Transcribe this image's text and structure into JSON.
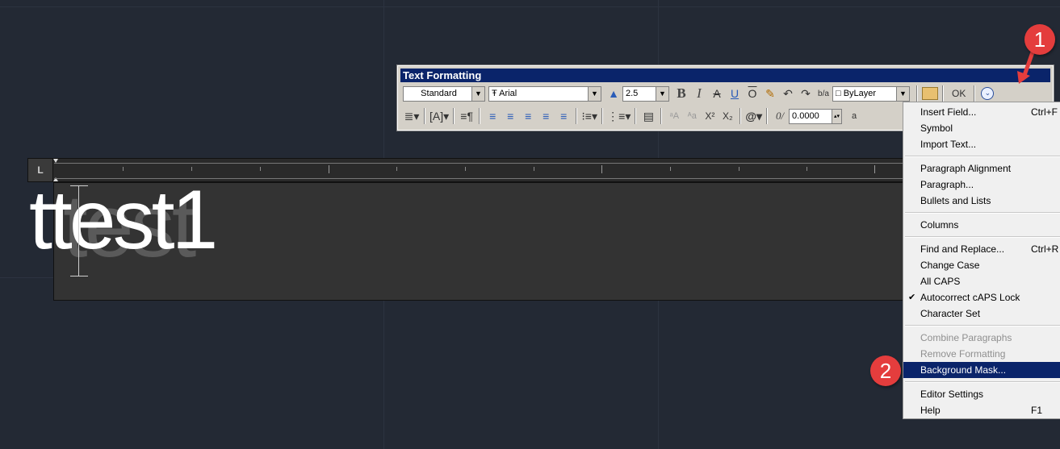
{
  "toolbar": {
    "title": "Text Formatting",
    "style_value": "Standard",
    "font_value": "Arial",
    "height_value": "2.5",
    "bold": "B",
    "italic": "I",
    "strike": "A",
    "underline": "U",
    "overline": "O",
    "undo": "↶",
    "redo": "↷",
    "stack": "b/a",
    "color_value": "ByLayer",
    "ok_label": "OK",
    "oblique_value": "0.0000",
    "at_symbol": "@",
    "oblique_label": "0/",
    "superscript": "X²",
    "subscript": "X₂"
  },
  "editor": {
    "ruler_corner": "L",
    "ghost_text": "test",
    "main_text": "ttest1"
  },
  "menu": {
    "items": [
      {
        "label": "Insert Field...",
        "shortcut": "Ctrl+F"
      },
      {
        "label": "Symbol",
        "shortcut": ""
      },
      {
        "label": "Import Text...",
        "shortcut": ""
      },
      {
        "label": "Paragraph Alignment",
        "shortcut": ""
      },
      {
        "label": "Paragraph...",
        "shortcut": ""
      },
      {
        "label": "Bullets and Lists",
        "shortcut": ""
      },
      {
        "label": "Columns",
        "shortcut": ""
      },
      {
        "label": "Find and Replace...",
        "shortcut": "Ctrl+R"
      },
      {
        "label": "Change Case",
        "shortcut": ""
      },
      {
        "label": "All CAPS",
        "shortcut": ""
      },
      {
        "label": "Autocorrect cAPS Lock",
        "shortcut": "",
        "checked": "✔"
      },
      {
        "label": "Character Set",
        "shortcut": ""
      },
      {
        "label": "Combine Paragraphs",
        "shortcut": ""
      },
      {
        "label": "Remove Formatting",
        "shortcut": ""
      },
      {
        "label": "Background Mask...",
        "shortcut": ""
      },
      {
        "label": "Editor Settings",
        "shortcut": ""
      },
      {
        "label": "Help",
        "shortcut": "F1"
      }
    ]
  },
  "callouts": {
    "one": "1",
    "two": "2"
  },
  "colors": {
    "background": "#232934",
    "titlebar": "#0a246a",
    "highlight": "#0a246a",
    "badge": "#e43d3d"
  }
}
